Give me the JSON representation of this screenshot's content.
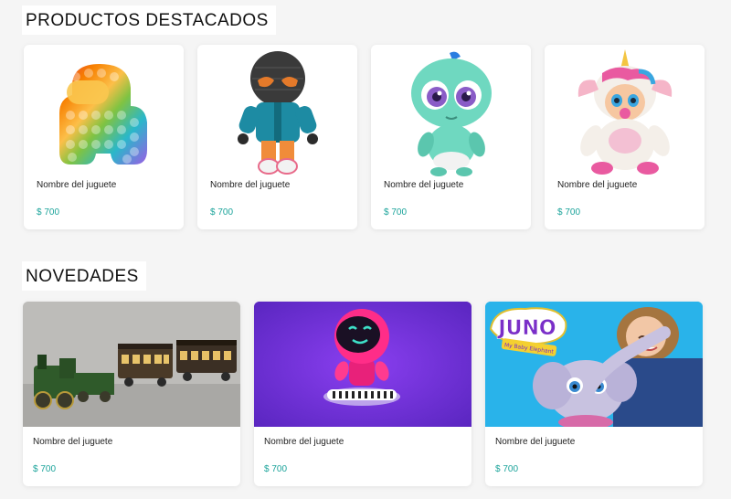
{
  "featured": {
    "title": "PRODUCTOS DESTACADOS",
    "items": [
      {
        "name": "Nombre del juguete",
        "price": "$ 700",
        "image": "rainbow-popit-toy"
      },
      {
        "name": "Nombre del juguete",
        "price": "$ 700",
        "image": "masked-plush-doll"
      },
      {
        "name": "Nombre del juguete",
        "price": "$ 700",
        "image": "green-baby-doll"
      },
      {
        "name": "Nombre del juguete",
        "price": "$ 700",
        "image": "unicorn-crybaby-doll"
      }
    ]
  },
  "new": {
    "title": "NOVEDADES",
    "items": [
      {
        "name": "Nombre del juguete",
        "price": "$ 700",
        "image": "vintage-toy-train"
      },
      {
        "name": "Nombre del juguete",
        "price": "$ 700",
        "image": "pink-robot-keyboard"
      },
      {
        "name": "Nombre del juguete",
        "price": "$ 700",
        "image": "juno-elephant-toy",
        "image_text": "JUNO",
        "image_subtext": "My Baby Elephant"
      }
    ]
  }
}
